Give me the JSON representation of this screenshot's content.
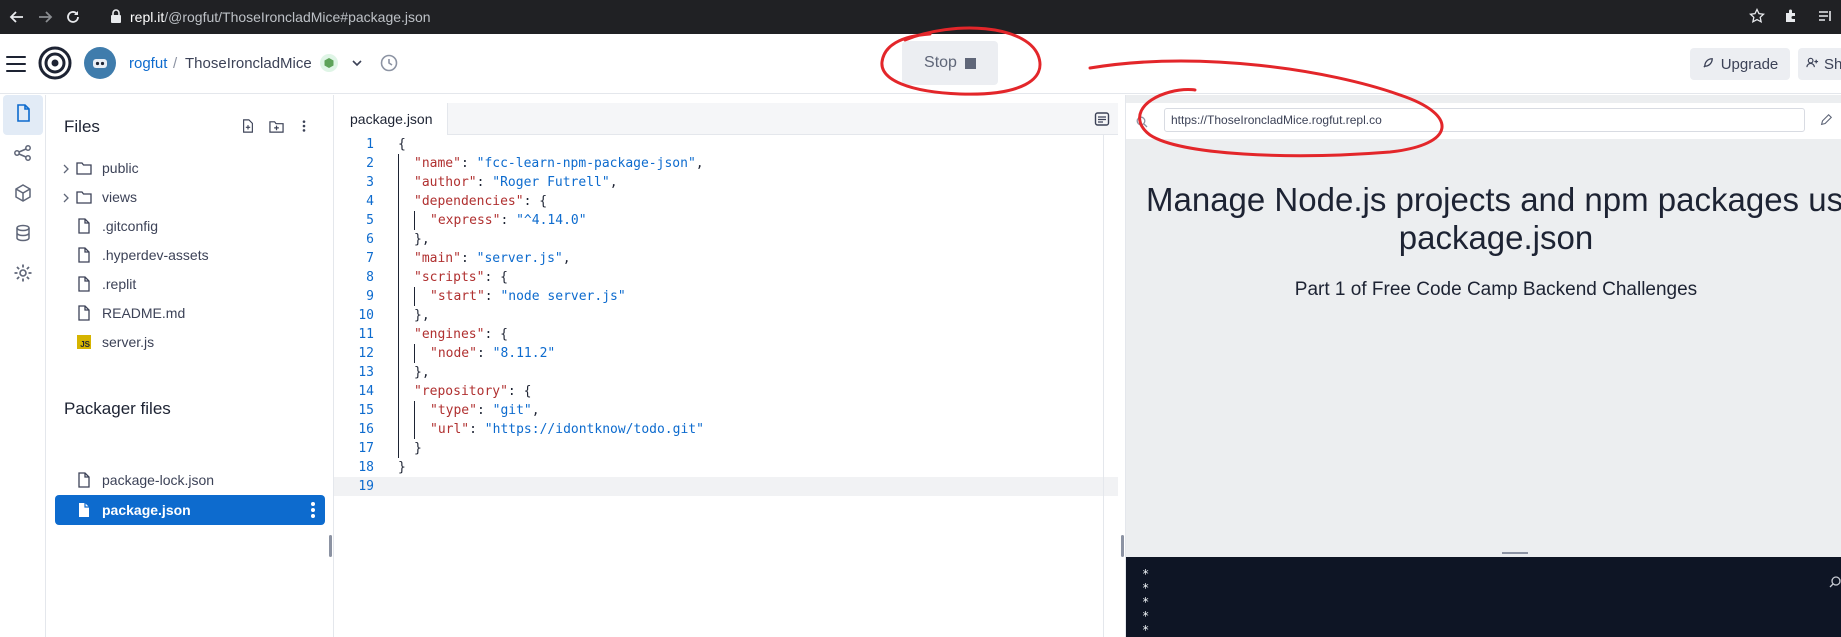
{
  "browser": {
    "url_host": "repl.it",
    "url_path": "/@rogfut/ThoseIroncladMice#package.json"
  },
  "header": {
    "owner": "rogfut",
    "separator": "/",
    "repl_name": "ThoseIroncladMice",
    "stop_label": "Stop",
    "upgrade_label": "Upgrade",
    "share_label": "Sha"
  },
  "sidebar": {
    "files_title": "Files",
    "files": [
      {
        "name": "public",
        "type": "folder"
      },
      {
        "name": "views",
        "type": "folder"
      },
      {
        "name": ".gitconfig",
        "type": "file"
      },
      {
        "name": ".hyperdev-assets",
        "type": "file"
      },
      {
        "name": ".replit",
        "type": "file"
      },
      {
        "name": "README.md",
        "type": "file"
      },
      {
        "name": "server.js",
        "type": "js"
      }
    ],
    "packager_title": "Packager files",
    "packager_files": [
      {
        "name": "package-lock.json",
        "selected": false
      },
      {
        "name": "package.json",
        "selected": true
      }
    ]
  },
  "editor": {
    "tab_label": "package.json",
    "line_numbers": [
      "1",
      "2",
      "3",
      "4",
      "5",
      "6",
      "7",
      "8",
      "9",
      "10",
      "11",
      "12",
      "13",
      "14",
      "15",
      "16",
      "17",
      "18",
      "19"
    ],
    "current_line": 19
  },
  "webview": {
    "url": "https://ThoseIroncladMice.rogfut.repl.co",
    "heading_line1": "Manage Node.js projects and npm packages usin",
    "heading_line2": "package.json",
    "subheading": "Part 1 of Free Code Camp Backend Challenges"
  },
  "console": {
    "lines": [
      "*",
      "*",
      "*",
      "*",
      "*"
    ]
  },
  "colors": {
    "accent": "#0d6bce",
    "annotation": "#e3262a",
    "console_bg": "#0e1525"
  }
}
